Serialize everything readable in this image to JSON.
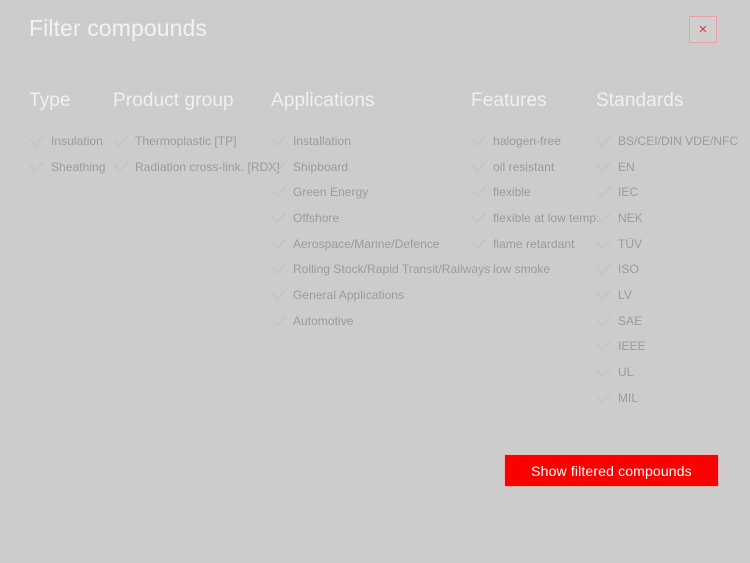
{
  "dialog": {
    "title": "Filter compounds",
    "close_label": "×",
    "close_icon": "close-icon",
    "check_icon": "check-icon",
    "accent_color": "#fc0000",
    "background_color": "#cccccc",
    "title_color": "#f2f2f2",
    "option_color": "#9b9b9b"
  },
  "columns": [
    {
      "id": "type",
      "title": "Type",
      "options": [
        {
          "label": "Insulation"
        },
        {
          "label": "Sheathing"
        }
      ]
    },
    {
      "id": "product-group",
      "title": "Product group",
      "options": [
        {
          "label": "Thermoplastic [TP]"
        },
        {
          "label": "Radiation cross-link. [RDX]"
        }
      ]
    },
    {
      "id": "applications",
      "title": "Applications",
      "options": [
        {
          "label": "Installation"
        },
        {
          "label": "Shipboard"
        },
        {
          "label": "Green Energy"
        },
        {
          "label": "Offshore"
        },
        {
          "label": "Aerospace/Marine/Defence"
        },
        {
          "label": "Rolling Stock/Rapid Transit/Railways"
        },
        {
          "label": "General Applications"
        },
        {
          "label": "Automotive"
        }
      ]
    },
    {
      "id": "features",
      "title": "Features",
      "options": [
        {
          "label": "halogen-free"
        },
        {
          "label": "oil resistant"
        },
        {
          "label": "flexible"
        },
        {
          "label": "flexible at low temp."
        },
        {
          "label": "flame retardant"
        },
        {
          "label": "low smoke"
        }
      ]
    },
    {
      "id": "standards",
      "title": "Standards",
      "options": [
        {
          "label": "BS/CEI/DIN VDE/NFC"
        },
        {
          "label": "EN"
        },
        {
          "label": "IEC"
        },
        {
          "label": "NEK"
        },
        {
          "label": "TÜV"
        },
        {
          "label": "ISO"
        },
        {
          "label": "LV"
        },
        {
          "label": "SAE"
        },
        {
          "label": "IEEE"
        },
        {
          "label": "UL"
        },
        {
          "label": "MIL"
        }
      ]
    }
  ],
  "footer": {
    "submit_label": "Show filtered compounds"
  }
}
